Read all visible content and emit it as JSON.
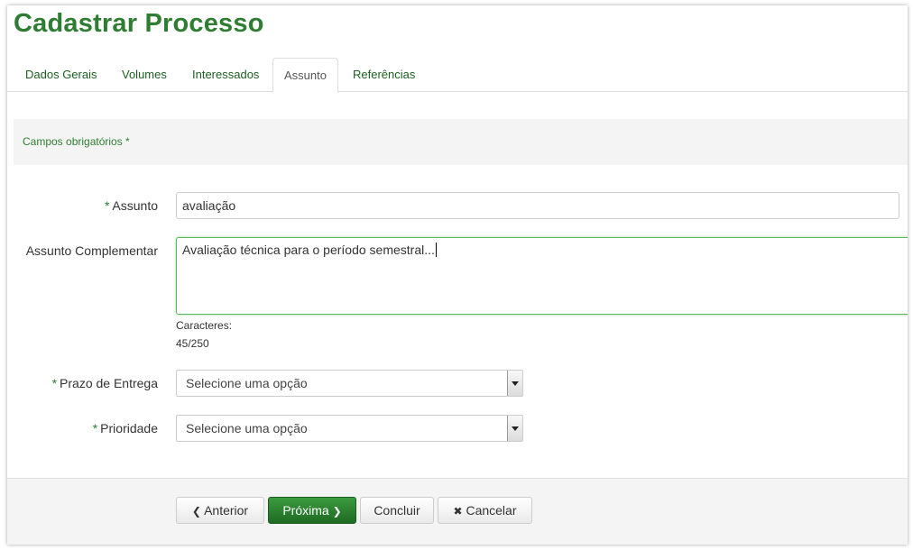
{
  "page": {
    "title": "Cadastrar Processo"
  },
  "tabs": [
    {
      "label": "Dados Gerais"
    },
    {
      "label": "Volumes"
    },
    {
      "label": "Interessados"
    },
    {
      "label": "Assunto"
    },
    {
      "label": "Referências"
    }
  ],
  "active_tab": "Assunto",
  "form": {
    "required_notice": "Campos obrigatórios *",
    "required_marker": "*",
    "assunto": {
      "label": "Assunto",
      "value": "avaliação"
    },
    "assunto_complementar": {
      "label": "Assunto Complementar",
      "value": "Avaliação técnica para o período semestral...",
      "counter_label": "Caracteres:",
      "counter_value": "45/250"
    },
    "prazo_entrega": {
      "label": "Prazo de Entrega",
      "selected": "Selecione uma opção"
    },
    "prioridade": {
      "label": "Prioridade",
      "selected": "Selecione uma opção"
    }
  },
  "buttons": {
    "anterior": {
      "label": "Anterior",
      "icon": "chevron-left-icon"
    },
    "proxima": {
      "label": "Próxima",
      "icon": "chevron-right-icon"
    },
    "concluir": {
      "label": "Concluir"
    },
    "cancelar": {
      "label": "Cancelar",
      "icon": "close-icon"
    }
  },
  "colors": {
    "brand_green": "#2e7d32",
    "primary_button": "#1e6b22",
    "band_background": "#f4f4f4"
  }
}
